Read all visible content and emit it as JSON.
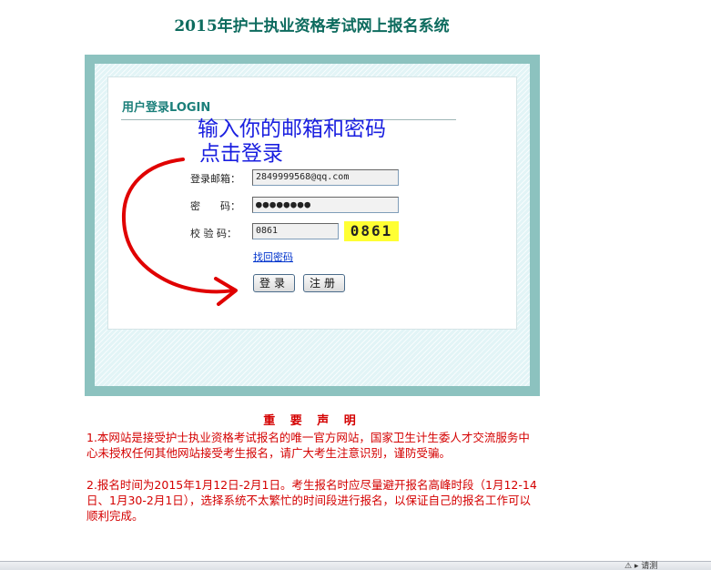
{
  "page_title": "2015年护士执业资格考试网上报名系统",
  "login": {
    "heading": "用户登录LOGIN",
    "annotation_line1": "输入你的邮箱和密码",
    "annotation_line2": "点击登录",
    "email_label": "登录邮箱：",
    "email_value": "2849999568@qq.com",
    "password_label": "密　　码：",
    "password_value": "●●●●●●●●",
    "captcha_label": "校 验 码：",
    "captcha_value": "0861",
    "captcha_image_text": "0861",
    "retrieve_password_link": "找回密码",
    "login_button": "登录",
    "register_button": "注册"
  },
  "notice": {
    "title": "重 要 声 明",
    "item1": "1.本网站是接受护士执业资格考试报名的唯一官方网站，国家卫生计生委人才交流服务中心未授权任何其他网站接受考生报名，请广大考生注意识别，谨防受骗。",
    "item2": "2.报名时间为2015年1月12日-2月1日。考生报名时应尽量避开报名高峰时段（1月12-14日、1月30-2月1日），选择系统不太繁忙的时间段进行报名，以保证自己的报名工作可以顺利完成。"
  },
  "statusbar": {
    "text": "⚠ ▸ 请测"
  },
  "colors": {
    "title": "#0d6b5e",
    "frame": "#8cc2bf",
    "annotation": "#1a1fe0",
    "arrow": "#e00000",
    "notice": "#d40000",
    "captcha_bg": "#ffff33"
  }
}
